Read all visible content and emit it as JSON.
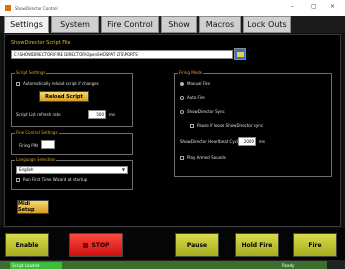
{
  "window": {
    "title": "ShowDirector Control",
    "controls": {
      "minimize": "–",
      "maximize": "▢",
      "close": "×"
    }
  },
  "tabs": [
    "Settings",
    "System",
    "Fire Control",
    "Show",
    "Macros",
    "Lock Outs"
  ],
  "active_tab": "Settings",
  "settings": {
    "script_file_label": "ShowDirector Script File",
    "script_file_path": "C:\\SHOWDIRECTOR\\FIRE DIRECTOR\\OpenSHOSPAT LTS\\PORTS",
    "folder_icon": "folder-icon",
    "script_settings": {
      "title": "Script Settings",
      "auto_reload_label": "Automatically reload script if changes",
      "reload_button": "Reload Script",
      "refresh_rate_label": "Script List refresh rate",
      "refresh_rate_value": "500",
      "refresh_rate_unit": "ms"
    },
    "fine_control": {
      "title": "Fine Control Settings",
      "fire_pin_label": "Firing PIN",
      "fire_pin_value": ""
    },
    "language": {
      "title": "Language Selection",
      "selected": "English",
      "first_time_label": "Run First Time Wizard at startup"
    },
    "midi_button": "Midi Setup",
    "firing_mode": {
      "title": "Firing Mode",
      "options": [
        "Manual Fire",
        "Auto Fire",
        "ShowDirector Sync"
      ],
      "selected": "Manual Fire",
      "pause_sync_label": "Pause if loose ShowDirector sync",
      "heartbeat_label": "ShowDirector Heartbeat Cycle",
      "heartbeat_value": "2000",
      "heartbeat_unit": "ms",
      "armed_sounds_label": "Play Armed Sounds"
    }
  },
  "actions": {
    "enable": "Enable",
    "stop": "STOP",
    "pause": "Pause",
    "hold_fire": "Hold Fire",
    "fire": "Fire"
  },
  "status": {
    "left": "Script Loaded",
    "right": "Ready"
  },
  "colors": {
    "gold_text": "#e3b431",
    "button_green": "#c2c83a",
    "button_red": "#e8231c",
    "status_green": "#3bbd3a"
  }
}
